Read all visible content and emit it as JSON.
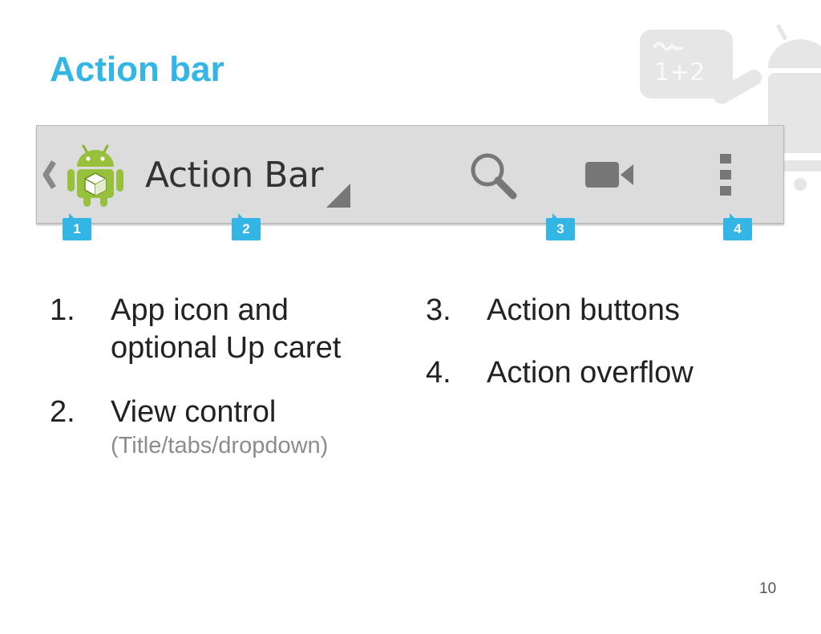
{
  "slide": {
    "title": "Action bar",
    "page_number": "10"
  },
  "mascot": {
    "board_text": "1+2"
  },
  "action_bar": {
    "title": "Action Bar",
    "icons": [
      "chevron-left-icon",
      "android-app-icon",
      "dropdown-triangle-icon",
      "search-icon",
      "video-camera-icon",
      "overflow-menu-icon"
    ]
  },
  "markers": [
    "1",
    "2",
    "3",
    "4"
  ],
  "list": {
    "items": [
      {
        "number": "1.",
        "text_line1": "App icon and",
        "text_line2": "optional Up caret"
      },
      {
        "number": "2.",
        "text": "View control",
        "subtext": "(Title/tabs/dropdown)"
      },
      {
        "number": "3.",
        "text": "Action buttons"
      },
      {
        "number": "4.",
        "text": "Action overflow"
      }
    ]
  },
  "colors": {
    "accent": "#33b5e5",
    "bar_background": "#dcdcdc",
    "icon_gray": "#777777"
  }
}
